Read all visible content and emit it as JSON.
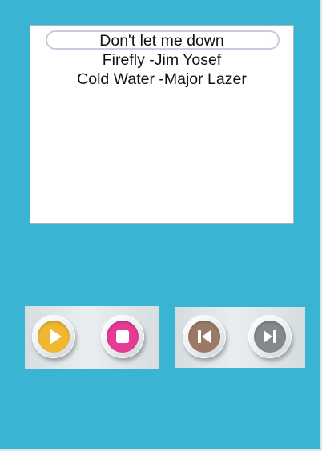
{
  "playlist": {
    "tracks": [
      {
        "title": "Don't let me down",
        "selected": true
      },
      {
        "title": "Firefly -Jim Yosef",
        "selected": false
      },
      {
        "title": "Cold Water -Major Lazer",
        "selected": false
      }
    ]
  },
  "controls": {
    "left_panel": [
      {
        "name": "play",
        "icon": "play-icon",
        "color": "#f2b731"
      },
      {
        "name": "stop",
        "icon": "stop-icon",
        "color": "#e63b94"
      }
    ],
    "right_panel": [
      {
        "name": "previous",
        "icon": "skip-back-icon",
        "color": "#9a7a66"
      },
      {
        "name": "next",
        "icon": "skip-forward-icon",
        "color": "#84898c"
      }
    ]
  },
  "colors": {
    "background": "#3ab4d3",
    "playlist_background": "#ffffff",
    "selected_outline": "#c6cde0"
  }
}
